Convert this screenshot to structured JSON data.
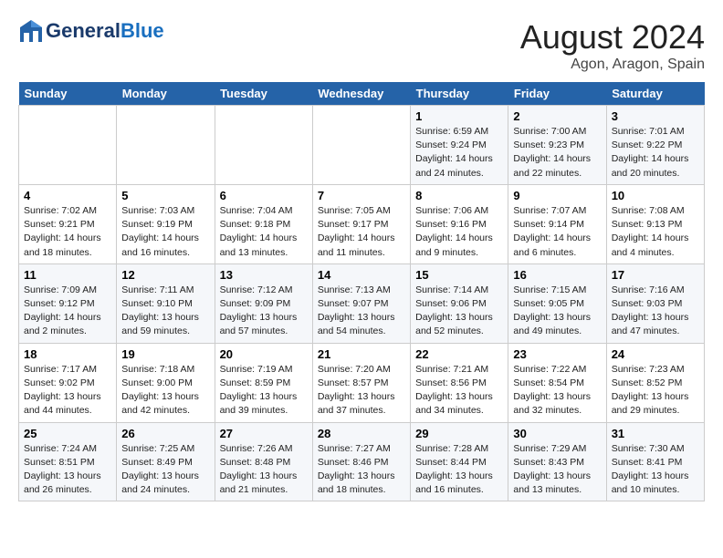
{
  "header": {
    "logo_line1": "General",
    "logo_line2": "Blue",
    "main_title": "August 2024",
    "subtitle": "Agon, Aragon, Spain"
  },
  "days_of_week": [
    "Sunday",
    "Monday",
    "Tuesday",
    "Wednesday",
    "Thursday",
    "Friday",
    "Saturday"
  ],
  "weeks": [
    [
      {
        "num": "",
        "info": ""
      },
      {
        "num": "",
        "info": ""
      },
      {
        "num": "",
        "info": ""
      },
      {
        "num": "",
        "info": ""
      },
      {
        "num": "1",
        "info": "Sunrise: 6:59 AM\nSunset: 9:24 PM\nDaylight: 14 hours\nand 24 minutes."
      },
      {
        "num": "2",
        "info": "Sunrise: 7:00 AM\nSunset: 9:23 PM\nDaylight: 14 hours\nand 22 minutes."
      },
      {
        "num": "3",
        "info": "Sunrise: 7:01 AM\nSunset: 9:22 PM\nDaylight: 14 hours\nand 20 minutes."
      }
    ],
    [
      {
        "num": "4",
        "info": "Sunrise: 7:02 AM\nSunset: 9:21 PM\nDaylight: 14 hours\nand 18 minutes."
      },
      {
        "num": "5",
        "info": "Sunrise: 7:03 AM\nSunset: 9:19 PM\nDaylight: 14 hours\nand 16 minutes."
      },
      {
        "num": "6",
        "info": "Sunrise: 7:04 AM\nSunset: 9:18 PM\nDaylight: 14 hours\nand 13 minutes."
      },
      {
        "num": "7",
        "info": "Sunrise: 7:05 AM\nSunset: 9:17 PM\nDaylight: 14 hours\nand 11 minutes."
      },
      {
        "num": "8",
        "info": "Sunrise: 7:06 AM\nSunset: 9:16 PM\nDaylight: 14 hours\nand 9 minutes."
      },
      {
        "num": "9",
        "info": "Sunrise: 7:07 AM\nSunset: 9:14 PM\nDaylight: 14 hours\nand 6 minutes."
      },
      {
        "num": "10",
        "info": "Sunrise: 7:08 AM\nSunset: 9:13 PM\nDaylight: 14 hours\nand 4 minutes."
      }
    ],
    [
      {
        "num": "11",
        "info": "Sunrise: 7:09 AM\nSunset: 9:12 PM\nDaylight: 14 hours\nand 2 minutes."
      },
      {
        "num": "12",
        "info": "Sunrise: 7:11 AM\nSunset: 9:10 PM\nDaylight: 13 hours\nand 59 minutes."
      },
      {
        "num": "13",
        "info": "Sunrise: 7:12 AM\nSunset: 9:09 PM\nDaylight: 13 hours\nand 57 minutes."
      },
      {
        "num": "14",
        "info": "Sunrise: 7:13 AM\nSunset: 9:07 PM\nDaylight: 13 hours\nand 54 minutes."
      },
      {
        "num": "15",
        "info": "Sunrise: 7:14 AM\nSunset: 9:06 PM\nDaylight: 13 hours\nand 52 minutes."
      },
      {
        "num": "16",
        "info": "Sunrise: 7:15 AM\nSunset: 9:05 PM\nDaylight: 13 hours\nand 49 minutes."
      },
      {
        "num": "17",
        "info": "Sunrise: 7:16 AM\nSunset: 9:03 PM\nDaylight: 13 hours\nand 47 minutes."
      }
    ],
    [
      {
        "num": "18",
        "info": "Sunrise: 7:17 AM\nSunset: 9:02 PM\nDaylight: 13 hours\nand 44 minutes."
      },
      {
        "num": "19",
        "info": "Sunrise: 7:18 AM\nSunset: 9:00 PM\nDaylight: 13 hours\nand 42 minutes."
      },
      {
        "num": "20",
        "info": "Sunrise: 7:19 AM\nSunset: 8:59 PM\nDaylight: 13 hours\nand 39 minutes."
      },
      {
        "num": "21",
        "info": "Sunrise: 7:20 AM\nSunset: 8:57 PM\nDaylight: 13 hours\nand 37 minutes."
      },
      {
        "num": "22",
        "info": "Sunrise: 7:21 AM\nSunset: 8:56 PM\nDaylight: 13 hours\nand 34 minutes."
      },
      {
        "num": "23",
        "info": "Sunrise: 7:22 AM\nSunset: 8:54 PM\nDaylight: 13 hours\nand 32 minutes."
      },
      {
        "num": "24",
        "info": "Sunrise: 7:23 AM\nSunset: 8:52 PM\nDaylight: 13 hours\nand 29 minutes."
      }
    ],
    [
      {
        "num": "25",
        "info": "Sunrise: 7:24 AM\nSunset: 8:51 PM\nDaylight: 13 hours\nand 26 minutes."
      },
      {
        "num": "26",
        "info": "Sunrise: 7:25 AM\nSunset: 8:49 PM\nDaylight: 13 hours\nand 24 minutes."
      },
      {
        "num": "27",
        "info": "Sunrise: 7:26 AM\nSunset: 8:48 PM\nDaylight: 13 hours\nand 21 minutes."
      },
      {
        "num": "28",
        "info": "Sunrise: 7:27 AM\nSunset: 8:46 PM\nDaylight: 13 hours\nand 18 minutes."
      },
      {
        "num": "29",
        "info": "Sunrise: 7:28 AM\nSunset: 8:44 PM\nDaylight: 13 hours\nand 16 minutes."
      },
      {
        "num": "30",
        "info": "Sunrise: 7:29 AM\nSunset: 8:43 PM\nDaylight: 13 hours\nand 13 minutes."
      },
      {
        "num": "31",
        "info": "Sunrise: 7:30 AM\nSunset: 8:41 PM\nDaylight: 13 hours\nand 10 minutes."
      }
    ]
  ]
}
